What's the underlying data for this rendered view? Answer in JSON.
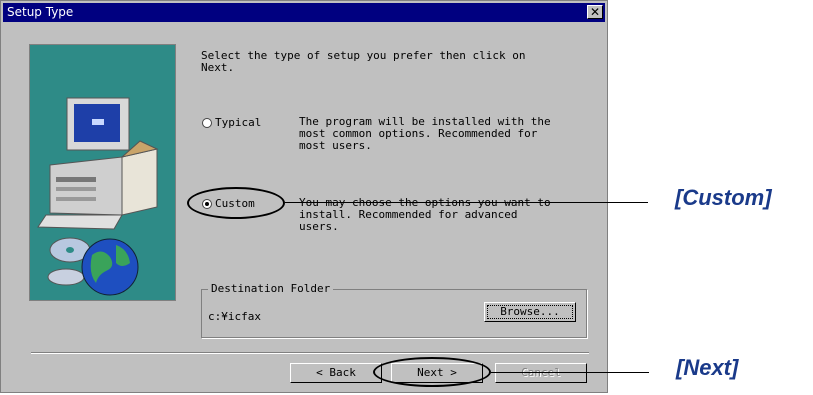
{
  "window": {
    "title": "Setup Type",
    "close_icon": "close-icon"
  },
  "instruction": [
    "Select the type of setup you prefer then click on",
    "Next."
  ],
  "options": [
    {
      "label": "Typical",
      "selected": false,
      "description": [
        "The program will be installed with the",
        "most common options. Recommended for",
        "most users."
      ]
    },
    {
      "label": "Custom",
      "selected": true,
      "description": [
        "You may choose the options you want to",
        "install. Recommended for advanced",
        "users."
      ]
    }
  ],
  "destination": {
    "group_label": "Destination Folder",
    "path": "c:¥icfax",
    "browse_label": "Browse..."
  },
  "buttons": {
    "back": "< Back",
    "next": "Next >",
    "cancel": "Cancel"
  },
  "callouts": {
    "custom": "[Custom]",
    "next": "[Next]"
  },
  "colors": {
    "title_bar": "#000080",
    "art_bg": "#2e8b87",
    "dialog_bg": "#c0c0c0",
    "callout_text": "#1a3a8a"
  }
}
